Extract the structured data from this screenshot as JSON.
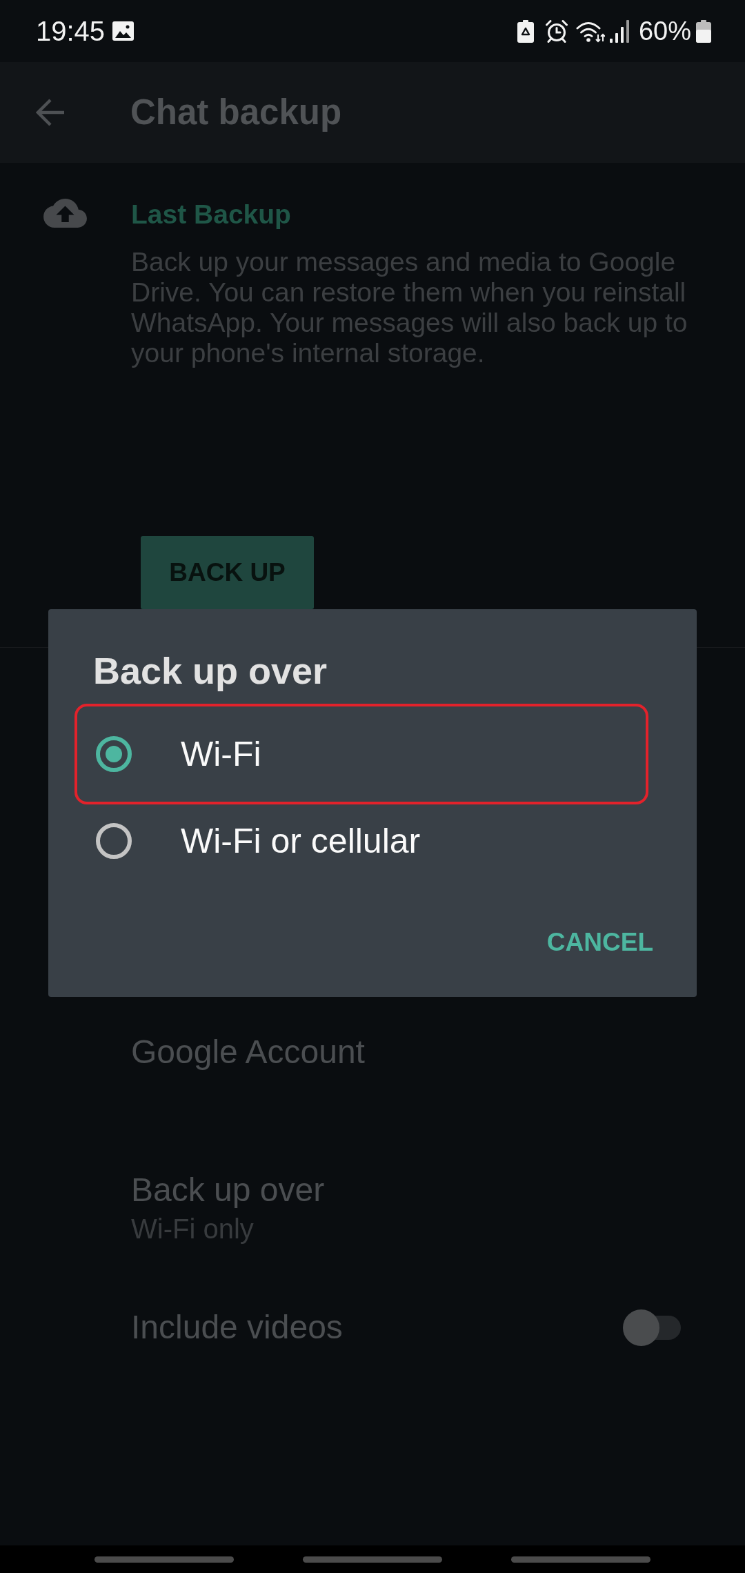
{
  "status_bar": {
    "time": "19:45",
    "battery": "60%"
  },
  "app_bar": {
    "title": "Chat backup"
  },
  "last_backup": {
    "heading": "Last Backup",
    "description": "Back up your messages and media to Google Drive. You can restore them when you reinstall WhatsApp. Your messages will also back up to your phone's internal storage.",
    "button": "BACK UP"
  },
  "settings": [
    {
      "kind": "link",
      "title": "Google Account"
    },
    {
      "kind": "value",
      "title": "Back up over",
      "subtitle": "Wi-Fi only"
    },
    {
      "kind": "toggle",
      "title": "Include videos",
      "on": false
    }
  ],
  "dialog": {
    "title": "Back up over",
    "options": [
      {
        "label": "Wi-Fi",
        "selected": true,
        "highlighted": true
      },
      {
        "label": "Wi-Fi or cellular",
        "selected": false,
        "highlighted": false
      }
    ],
    "buttons": [
      "CANCEL"
    ]
  }
}
